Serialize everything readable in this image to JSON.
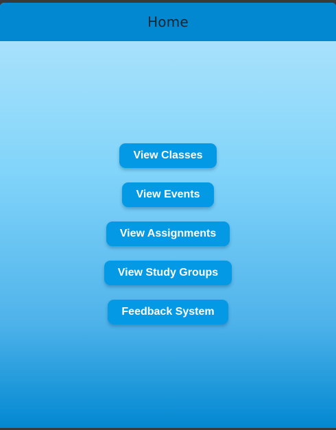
{
  "app_bar": {
    "title": "Home"
  },
  "buttons": [
    {
      "label": "View Classes"
    },
    {
      "label": "View Events"
    },
    {
      "label": "View Assignments"
    },
    {
      "label": "View Study Groups"
    },
    {
      "label": "Feedback System"
    }
  ],
  "colors": {
    "app_bar": "#0288d1",
    "button": "#0399e5",
    "gradient_top": "#b3e5fc",
    "gradient_bottom": "#0288d1"
  }
}
